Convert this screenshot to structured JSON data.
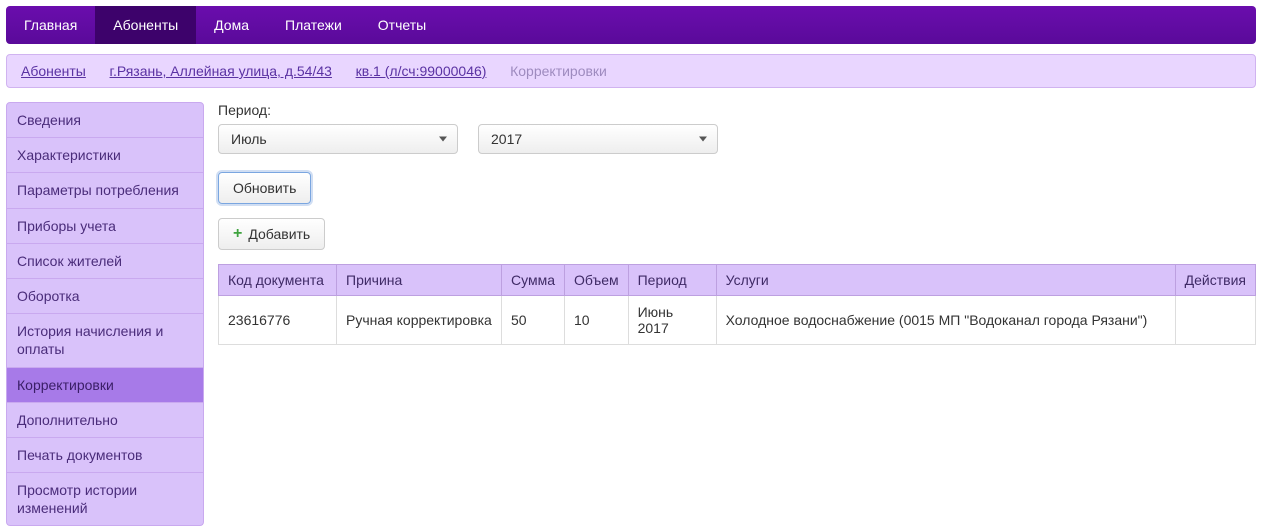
{
  "topnav": {
    "items": [
      {
        "label": "Главная",
        "active": false
      },
      {
        "label": "Абоненты",
        "active": true
      },
      {
        "label": "Дома",
        "active": false
      },
      {
        "label": "Платежи",
        "active": false
      },
      {
        "label": "Отчеты",
        "active": false
      }
    ]
  },
  "breadcrumb": {
    "items": [
      {
        "label": "Абоненты",
        "link": true
      },
      {
        "label": "г.Рязань, Аллейная улица, д.54/43",
        "link": true
      },
      {
        "label": " кв.1 (л/сч:99000046)",
        "link": true
      },
      {
        "label": "Корректировки",
        "link": false
      }
    ]
  },
  "sidebar": {
    "items": [
      {
        "label": "Сведения",
        "active": false
      },
      {
        "label": "Характеристики",
        "active": false
      },
      {
        "label": "Параметры потребления",
        "active": false
      },
      {
        "label": "Приборы учета",
        "active": false
      },
      {
        "label": "Список жителей",
        "active": false
      },
      {
        "label": "Оборотка",
        "active": false
      },
      {
        "label": "История начисления и оплаты",
        "active": false
      },
      {
        "label": "Корректировки",
        "active": true
      },
      {
        "label": "Дополнительно",
        "active": false
      },
      {
        "label": "Печать документов",
        "active": false
      },
      {
        "label": "Просмотр истории изменений",
        "active": false
      }
    ]
  },
  "period": {
    "label": "Период:",
    "month": "Июль",
    "year": "2017"
  },
  "buttons": {
    "refresh": "Обновить",
    "add": "Добавить"
  },
  "table": {
    "headers": {
      "doc_code": "Код документа",
      "reason": "Причина",
      "sum": "Сумма",
      "volume": "Объем",
      "period": "Период",
      "services": "Услуги",
      "actions": "Действия"
    },
    "rows": [
      {
        "doc_code": "23616776",
        "reason": "Ручная корректировка",
        "sum": "50",
        "volume": "10",
        "period": "Июнь 2017",
        "services": "Холодное водоснабжение (0015 МП \"Водоканал города Рязани\")",
        "actions": ""
      }
    ]
  }
}
